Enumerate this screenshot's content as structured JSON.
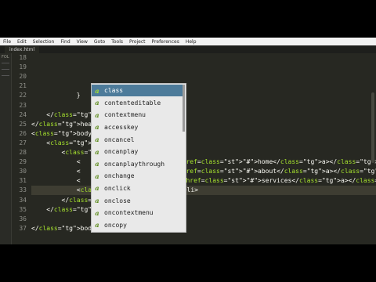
{
  "menu": [
    "File",
    "Edit",
    "Selection",
    "Find",
    "View",
    "Goto",
    "Tools",
    "Project",
    "Preferences",
    "Help"
  ],
  "tab": {
    "label": "index.html"
  },
  "sidebar": {
    "label": "FOL"
  },
  "lines": [
    {
      "n": "18",
      "text": ""
    },
    {
      "n": "19",
      "text": ""
    },
    {
      "n": "20",
      "text": ""
    },
    {
      "n": "21",
      "text": ""
    },
    {
      "n": "22",
      "text": "            }"
    },
    {
      "n": "23",
      "text": ""
    },
    {
      "n": "24",
      "text": "    </style>"
    },
    {
      "n": "25",
      "text": "</head>"
    },
    {
      "n": "26",
      "text": "<body>"
    },
    {
      "n": "27",
      "text": "    <nav clas"
    },
    {
      "n": "28",
      "text": "        <ul c"
    },
    {
      "n": "29",
      "text": "            <                           href=\"#\">home</a></li>"
    },
    {
      "n": "30",
      "text": "            <                           href=\"#\">about</a></li>"
    },
    {
      "n": "31",
      "text": "            <                          n href=\"#\">services</a></li>"
    },
    {
      "n": "33",
      "text": "            <li c</li>"
    },
    {
      "n": "34",
      "text": "        </ul>"
    },
    {
      "n": "35",
      "text": "    </nav>"
    },
    {
      "n": "36",
      "text": ""
    },
    {
      "n": "37",
      "text": "</body>"
    }
  ],
  "autocomplete": {
    "icon_letter": "a",
    "selected_index": 0,
    "items": [
      "class",
      "contenteditable",
      "contextmenu",
      "accesskey",
      "oncancel",
      "oncanplay",
      "oncanplaythrough",
      "onchange",
      "onclick",
      "onclose",
      "oncontextmenu",
      "oncopy"
    ]
  },
  "colors": {
    "background": "#272822",
    "tag": "#f92672",
    "attr": "#a6e22e",
    "string": "#e6db74",
    "selection": "#4d7b9a"
  }
}
